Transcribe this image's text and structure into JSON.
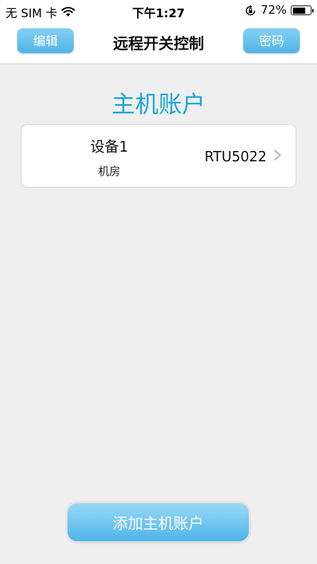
{
  "status_bar": {
    "carrier": "无 SIM 卡",
    "time": "下午1:27",
    "battery_percent": "72%",
    "battery_level": 0.72
  },
  "nav": {
    "edit_label": "编辑",
    "title": "远程开关控制",
    "password_label": "密码"
  },
  "section_title": "主机账户",
  "devices": [
    {
      "name": "设备1",
      "location": "机房",
      "model": "RTU5022"
    }
  ],
  "add_button_label": "添加主机账户",
  "colors": {
    "accent": "#1ba6d6",
    "button_top": "#86d0f2",
    "button_bottom": "#4fb4e8",
    "background": "#efeff0"
  }
}
